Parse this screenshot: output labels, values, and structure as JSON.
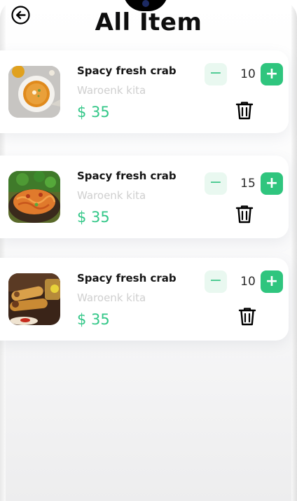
{
  "header": {
    "title": "All Item",
    "back_icon": "back-arrow-icon"
  },
  "colors": {
    "accent": "#2fc57e",
    "price": "#33c788",
    "subtitle": "#cfcfcf",
    "minus_bg": "#e9f8f0"
  },
  "items": [
    {
      "name": "Spacy fresh crab",
      "store": "Waroenk kita",
      "price": "$ 35",
      "quantity": "10",
      "minus_label": "−",
      "plus_label": "+",
      "image": "soup-bowl-image"
    },
    {
      "name": "Spacy fresh crab",
      "store": "Waroenk kita",
      "price": "$ 35",
      "quantity": "15",
      "minus_label": "−",
      "plus_label": "+",
      "image": "pasta-plate-image"
    },
    {
      "name": "Spacy fresh crab",
      "store": "Waroenk kita",
      "price": "$ 35",
      "quantity": "10",
      "minus_label": "−",
      "plus_label": "+",
      "image": "spring-rolls-image"
    }
  ]
}
